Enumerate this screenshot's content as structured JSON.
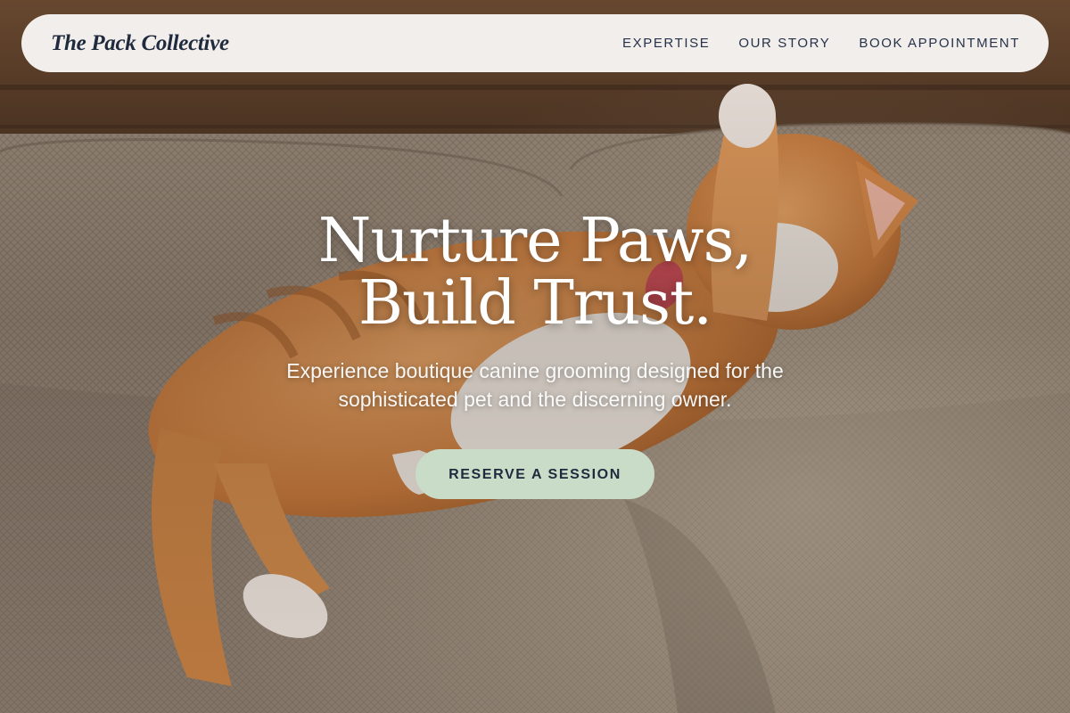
{
  "nav": {
    "brand": "The Pack Collective",
    "links": [
      {
        "label": "EXPERTISE"
      },
      {
        "label": "OUR STORY"
      },
      {
        "label": "BOOK APPOINTMENT"
      }
    ]
  },
  "hero": {
    "title_line1": "Nurture Paws,",
    "title_line2": "Build Trust.",
    "subtitle": "Experience boutique canine grooming designed for the sophisticated pet and the discerning owner.",
    "cta_label": "RESERVE A SESSION",
    "image_subject": "orange-tabby-cat-on-couch"
  },
  "colors": {
    "nav_bg": "#faf8f6",
    "brand_text": "#1f2a3d",
    "cta_bg": "#c8dcc8",
    "cta_text": "#1f2a3d",
    "hero_text": "#ffffff"
  }
}
